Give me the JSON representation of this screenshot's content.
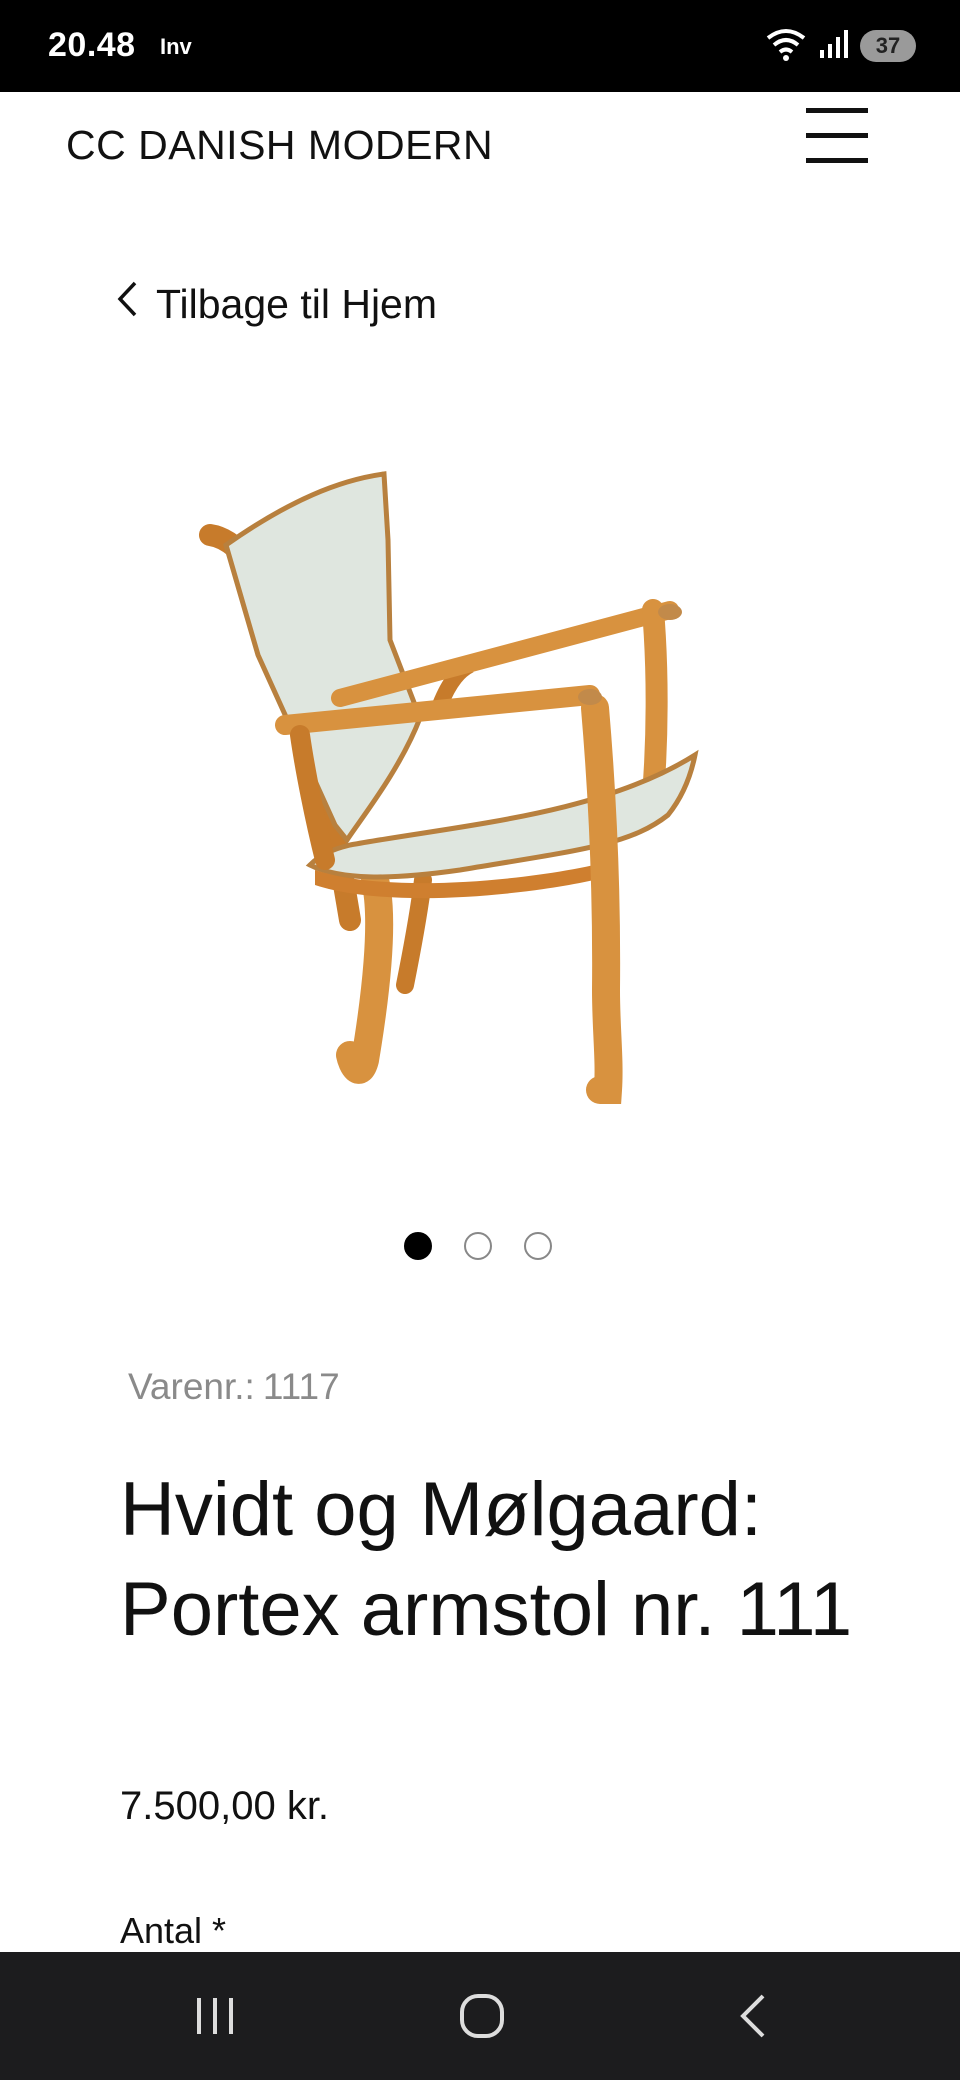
{
  "status_bar": {
    "time": "20.48",
    "carrier_label": "Inv",
    "battery": "37"
  },
  "header": {
    "brand": "CC DANISH MODERN"
  },
  "nav": {
    "back_label": "Tilbage til Hjem"
  },
  "gallery": {
    "slide_count": 3,
    "active_index": 0
  },
  "product": {
    "sku_label": "Varenr.:",
    "sku_value": "1117",
    "title": "Hvidt og Mølgaard: Portex armstol nr. 111",
    "price": "7.500,00 kr.",
    "quantity_label": "Antal *"
  },
  "colors": {
    "status_bar_bg": "#000000",
    "nav_bar_bg": "#1c1c1e",
    "text": "#111111",
    "muted_text": "#8a8a8a",
    "wood": "#d8923f",
    "upholstery": "#dfe6df"
  }
}
